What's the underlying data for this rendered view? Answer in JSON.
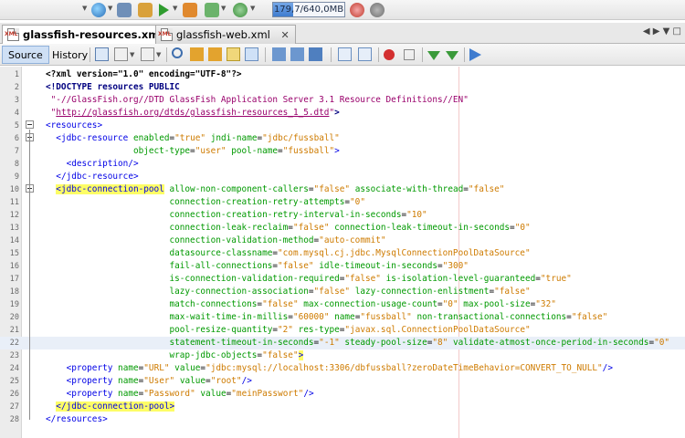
{
  "toolbar": {
    "memory_text": "179,7/640,0MB",
    "memory_fraction": 0.28,
    "icons": [
      "globe-icon",
      "run-icon",
      "build-icon",
      "hammer-icon",
      "play-icon",
      "clean-build-icon",
      "debug-icon",
      "profile-icon",
      "gc-icon",
      "settings-icon"
    ]
  },
  "tabs": [
    {
      "label": "glassfish-resources.xml",
      "active": true
    },
    {
      "label": "glassfish-web.xml",
      "active": false
    }
  ],
  "editor_toolbar": {
    "source_label": "Source",
    "history_label": "History"
  },
  "code_lines": [
    {
      "n": "1",
      "segs": [
        [
          "t-pi",
          "<?xml version=\"1.0\" encoding=\"UTF-8\"?>"
        ]
      ]
    },
    {
      "n": "2",
      "segs": [
        [
          "t-doc",
          "<!DOCTYPE resources PUBLIC"
        ]
      ]
    },
    {
      "n": "3",
      "segs": [
        [
          "t-txt",
          " "
        ],
        [
          "t-str",
          "\"-//GlassFish.org//DTD GlassFish Application Server 3.1 Resource Definitions//EN\""
        ]
      ]
    },
    {
      "n": "4",
      "segs": [
        [
          "t-txt",
          " "
        ],
        [
          "t-str",
          "\""
        ],
        [
          "t-url",
          "http://glassfish.org/dtds/glassfish-resources_1_5.dtd"
        ],
        [
          "t-str",
          "\""
        ],
        [
          "t-doc",
          ">"
        ]
      ]
    },
    {
      "n": "5",
      "segs": [
        [
          "t-tag",
          "<resources>"
        ]
      ]
    },
    {
      "n": "6",
      "segs": [
        [
          "t-txt",
          "  "
        ],
        [
          "t-tag",
          "<jdbc-resource"
        ],
        [
          "t-txt",
          " "
        ],
        [
          "t-attr",
          "enabled"
        ],
        [
          "t-txt",
          "="
        ],
        [
          "t-val",
          "\"true\""
        ],
        [
          "t-txt",
          " "
        ],
        [
          "t-attr",
          "jndi-name"
        ],
        [
          "t-txt",
          "="
        ],
        [
          "t-val",
          "\"jdbc/fussball\""
        ]
      ]
    },
    {
      "n": "7",
      "segs": [
        [
          "t-txt",
          "                 "
        ],
        [
          "t-attr",
          "object-type"
        ],
        [
          "t-txt",
          "="
        ],
        [
          "t-val",
          "\"user\""
        ],
        [
          "t-txt",
          " "
        ],
        [
          "t-attr",
          "pool-name"
        ],
        [
          "t-txt",
          "="
        ],
        [
          "t-val",
          "\"fussball\""
        ],
        [
          "t-tag",
          ">"
        ]
      ]
    },
    {
      "n": "8",
      "segs": [
        [
          "t-txt",
          "    "
        ],
        [
          "t-tag",
          "<description/>"
        ]
      ]
    },
    {
      "n": "9",
      "segs": [
        [
          "t-txt",
          "  "
        ],
        [
          "t-tag",
          "</jdbc-resource>"
        ]
      ]
    },
    {
      "n": "10",
      "segs": [
        [
          "t-txt",
          "  "
        ],
        [
          "hl t-tag",
          "<jdbc-connection-pool"
        ],
        [
          "t-txt",
          " "
        ],
        [
          "t-attr",
          "allow-non-component-callers"
        ],
        [
          "t-txt",
          "="
        ],
        [
          "t-val",
          "\"false\""
        ],
        [
          "t-txt",
          " "
        ],
        [
          "t-attr",
          "associate-with-thread"
        ],
        [
          "t-txt",
          "="
        ],
        [
          "t-val",
          "\"false\""
        ]
      ]
    },
    {
      "n": "11",
      "segs": [
        [
          "t-txt",
          "                        "
        ],
        [
          "t-attr",
          "connection-creation-retry-attempts"
        ],
        [
          "t-txt",
          "="
        ],
        [
          "t-val",
          "\"0\""
        ]
      ]
    },
    {
      "n": "12",
      "segs": [
        [
          "t-txt",
          "                        "
        ],
        [
          "t-attr",
          "connection-creation-retry-interval-in-seconds"
        ],
        [
          "t-txt",
          "="
        ],
        [
          "t-val",
          "\"10\""
        ]
      ]
    },
    {
      "n": "13",
      "segs": [
        [
          "t-txt",
          "                        "
        ],
        [
          "t-attr",
          "connection-leak-reclaim"
        ],
        [
          "t-txt",
          "="
        ],
        [
          "t-val",
          "\"false\""
        ],
        [
          "t-txt",
          " "
        ],
        [
          "t-attr",
          "connection-leak-timeout-in-seconds"
        ],
        [
          "t-txt",
          "="
        ],
        [
          "t-val",
          "\"0\""
        ]
      ]
    },
    {
      "n": "14",
      "segs": [
        [
          "t-txt",
          "                        "
        ],
        [
          "t-attr",
          "connection-validation-method"
        ],
        [
          "t-txt",
          "="
        ],
        [
          "t-val",
          "\"auto-commit\""
        ]
      ]
    },
    {
      "n": "15",
      "segs": [
        [
          "t-txt",
          "                        "
        ],
        [
          "t-attr",
          "datasource-classname"
        ],
        [
          "t-txt",
          "="
        ],
        [
          "t-val",
          "\"com.mysql.cj.jdbc.MysqlConnectionPoolDataSource\""
        ]
      ]
    },
    {
      "n": "16",
      "segs": [
        [
          "t-txt",
          "                        "
        ],
        [
          "t-attr",
          "fail-all-connections"
        ],
        [
          "t-txt",
          "="
        ],
        [
          "t-val",
          "\"false\""
        ],
        [
          "t-txt",
          " "
        ],
        [
          "t-attr",
          "idle-timeout-in-seconds"
        ],
        [
          "t-txt",
          "="
        ],
        [
          "t-val",
          "\"300\""
        ]
      ]
    },
    {
      "n": "17",
      "segs": [
        [
          "t-txt",
          "                        "
        ],
        [
          "t-attr",
          "is-connection-validation-required"
        ],
        [
          "t-txt",
          "="
        ],
        [
          "t-val",
          "\"false\""
        ],
        [
          "t-txt",
          " "
        ],
        [
          "t-attr",
          "is-isolation-level-guaranteed"
        ],
        [
          "t-txt",
          "="
        ],
        [
          "t-val",
          "\"true\""
        ]
      ]
    },
    {
      "n": "18",
      "segs": [
        [
          "t-txt",
          "                        "
        ],
        [
          "t-attr",
          "lazy-connection-association"
        ],
        [
          "t-txt",
          "="
        ],
        [
          "t-val",
          "\"false\""
        ],
        [
          "t-txt",
          " "
        ],
        [
          "t-attr",
          "lazy-connection-enlistment"
        ],
        [
          "t-txt",
          "="
        ],
        [
          "t-val",
          "\"false\""
        ]
      ]
    },
    {
      "n": "19",
      "segs": [
        [
          "t-txt",
          "                        "
        ],
        [
          "t-attr",
          "match-connections"
        ],
        [
          "t-txt",
          "="
        ],
        [
          "t-val",
          "\"false\""
        ],
        [
          "t-txt",
          " "
        ],
        [
          "t-attr",
          "max-connection-usage-count"
        ],
        [
          "t-txt",
          "="
        ],
        [
          "t-val",
          "\"0\""
        ],
        [
          "t-txt",
          " "
        ],
        [
          "t-attr",
          "max-pool-size"
        ],
        [
          "t-txt",
          "="
        ],
        [
          "t-val",
          "\"32\""
        ]
      ]
    },
    {
      "n": "20",
      "segs": [
        [
          "t-txt",
          "                        "
        ],
        [
          "t-attr",
          "max-wait-time-in-millis"
        ],
        [
          "t-txt",
          "="
        ],
        [
          "t-val",
          "\"60000\""
        ],
        [
          "t-txt",
          " "
        ],
        [
          "t-attr",
          "name"
        ],
        [
          "t-txt",
          "="
        ],
        [
          "t-val",
          "\"fussball\""
        ],
        [
          "t-txt",
          " "
        ],
        [
          "t-attr",
          "non-transactional-connections"
        ],
        [
          "t-txt",
          "="
        ],
        [
          "t-val",
          "\"false\""
        ]
      ]
    },
    {
      "n": "21",
      "segs": [
        [
          "t-txt",
          "                        "
        ],
        [
          "t-attr",
          "pool-resize-quantity"
        ],
        [
          "t-txt",
          "="
        ],
        [
          "t-val",
          "\"2\""
        ],
        [
          "t-txt",
          " "
        ],
        [
          "t-attr",
          "res-type"
        ],
        [
          "t-txt",
          "="
        ],
        [
          "t-val",
          "\"javax.sql.ConnectionPoolDataSource\""
        ]
      ]
    },
    {
      "n": "22",
      "current": true,
      "segs": [
        [
          "t-txt",
          "                        "
        ],
        [
          "t-attr",
          "statement-timeout-in-seconds"
        ],
        [
          "t-txt",
          "="
        ],
        [
          "t-val",
          "\"-1\""
        ],
        [
          "t-txt",
          " "
        ],
        [
          "t-attr",
          "steady-pool-size"
        ],
        [
          "t-txt",
          "="
        ],
        [
          "t-val",
          "\"8\""
        ],
        [
          "t-txt",
          " "
        ],
        [
          "t-attr",
          "validate-atmost-once-period-in-seconds"
        ],
        [
          "t-txt",
          "="
        ],
        [
          "t-val",
          "\"0\""
        ]
      ]
    },
    {
      "n": "23",
      "segs": [
        [
          "t-txt",
          "                        "
        ],
        [
          "t-attr",
          "wrap-jdbc-objects"
        ],
        [
          "t-txt",
          "="
        ],
        [
          "t-val",
          "\"false\""
        ],
        [
          "hl t-tag",
          ">"
        ]
      ]
    },
    {
      "n": "24",
      "segs": [
        [
          "t-txt",
          "    "
        ],
        [
          "t-tag",
          "<property"
        ],
        [
          "t-txt",
          " "
        ],
        [
          "t-attr",
          "name"
        ],
        [
          "t-txt",
          "="
        ],
        [
          "t-val",
          "\"URL\""
        ],
        [
          "t-txt",
          " "
        ],
        [
          "t-attr",
          "value"
        ],
        [
          "t-txt",
          "="
        ],
        [
          "t-val",
          "\"jdbc:mysql://localhost:3306/dbfussball?zeroDateTimeBehavior=CONVERT_TO_NULL\""
        ],
        [
          "t-tag",
          "/>"
        ]
      ]
    },
    {
      "n": "25",
      "segs": [
        [
          "t-txt",
          "    "
        ],
        [
          "t-tag",
          "<property"
        ],
        [
          "t-txt",
          " "
        ],
        [
          "t-attr",
          "name"
        ],
        [
          "t-txt",
          "="
        ],
        [
          "t-val",
          "\"User\""
        ],
        [
          "t-txt",
          " "
        ],
        [
          "t-attr",
          "value"
        ],
        [
          "t-txt",
          "="
        ],
        [
          "t-val",
          "\"root\""
        ],
        [
          "t-tag",
          "/>"
        ]
      ]
    },
    {
      "n": "26",
      "segs": [
        [
          "t-txt",
          "    "
        ],
        [
          "t-tag",
          "<property"
        ],
        [
          "t-txt",
          " "
        ],
        [
          "t-attr",
          "name"
        ],
        [
          "t-txt",
          "="
        ],
        [
          "t-val",
          "\"Password\""
        ],
        [
          "t-txt",
          " "
        ],
        [
          "t-attr",
          "value"
        ],
        [
          "t-txt",
          "="
        ],
        [
          "t-val",
          "\"meinPasswort\""
        ],
        [
          "t-tag",
          "/>"
        ]
      ]
    },
    {
      "n": "27",
      "segs": [
        [
          "t-txt",
          "  "
        ],
        [
          "hl t-tag",
          "</jdbc-connection-pool>"
        ]
      ]
    },
    {
      "n": "28",
      "segs": [
        [
          "t-tag",
          "</resources>"
        ]
      ]
    }
  ]
}
